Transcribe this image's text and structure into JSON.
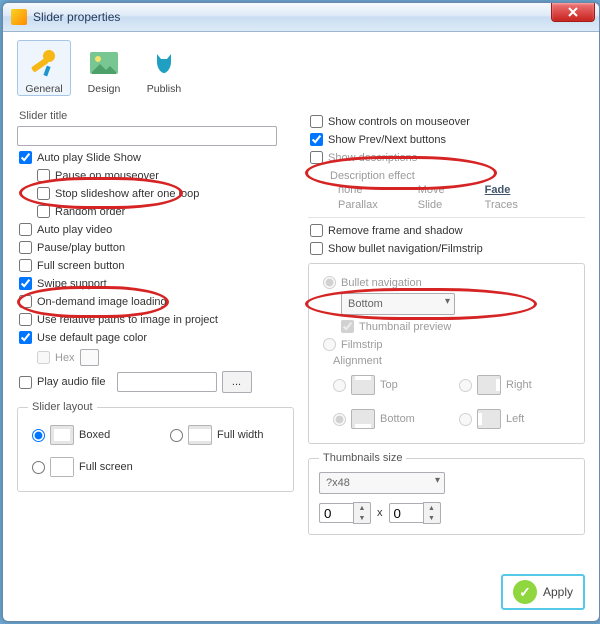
{
  "titlebar": {
    "title": "Slider properties"
  },
  "tabs": {
    "general": "General",
    "design": "Design",
    "publish": "Publish"
  },
  "left": {
    "slider_title_label": "Slider title",
    "slider_title_value": "",
    "autoplay": "Auto play Slide Show",
    "pause_mouseover": "Pause on mouseover",
    "stop_one_loop": "Stop slideshow after one loop",
    "random_order": "Random order",
    "autoplay_video": "Auto play video",
    "pause_play_button": "Pause/play button",
    "fullscreen_button": "Full screen button",
    "swipe_support": "Swipe support",
    "on_demand_loading": "On-demand image loading",
    "relative_paths": "Use relative paths to image in project",
    "default_page_color": "Use default page color",
    "hex_label": "Hex",
    "hex_value": "",
    "play_audio": "Play audio file",
    "audio_path_value": "",
    "browse_label": "...",
    "layout_legend": "Slider layout",
    "layout": {
      "boxed": "Boxed",
      "full_width": "Full width",
      "full_screen": "Full screen"
    }
  },
  "right": {
    "show_controls_mouseover": "Show controls on mouseover",
    "show_prev_next": "Show Prev/Next buttons",
    "show_descriptions": "Show descriptions",
    "description_effect_label": "Description effect",
    "effects": {
      "none": "none",
      "move": "Move",
      "fade": "Fade",
      "parallax": "Parallax",
      "slide": "Slide",
      "traces": "Traces"
    },
    "remove_frame_shadow": "Remove frame and shadow",
    "show_bullet_filmstrip": "Show bullet navigation/Filmstrip",
    "bullet_navigation": "Bullet navigation",
    "bullet_position": "Bottom",
    "thumbnail_preview": "Thumbnail preview",
    "filmstrip": "Filmstrip",
    "alignment_label": "Alignment",
    "align": {
      "top": "Top",
      "right": "Right",
      "bottom": "Bottom",
      "left": "Left"
    },
    "thumbnails_size_legend": "Thumbnails size",
    "thumb_size_select": "?x48",
    "thumb_w": "0",
    "thumb_h": "0",
    "times": "x"
  },
  "apply_label": "Apply"
}
